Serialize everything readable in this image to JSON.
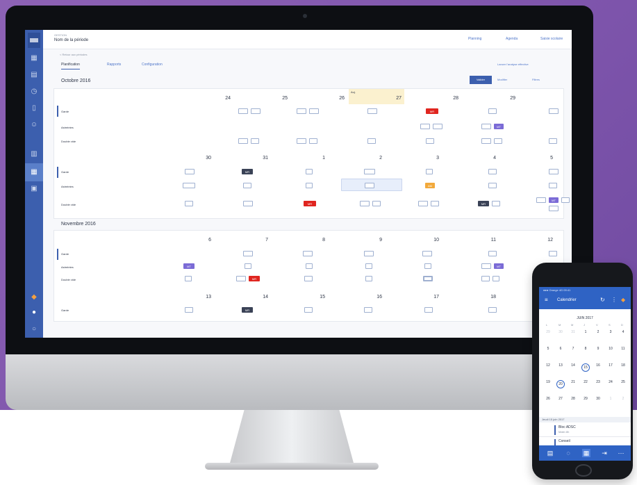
{
  "app": {
    "subtitle": "GESTION",
    "title": "Nom de la période",
    "actions": [
      "Planning",
      "Agenda",
      "Saisie scolaire"
    ]
  },
  "breadcrumb": "< Retour aux périodes",
  "tabs": [
    "Planification",
    "Rapports",
    "Configuration"
  ],
  "sync_label": "Lancer l'analyse effective",
  "toolbar": {
    "primary": "Valider",
    "link1": "Modifier",
    "link2": "Filtres"
  },
  "months": [
    "Octobre 2016",
    "Novembre 2016"
  ],
  "rows": [
    "Garde",
    "Astreintes",
    "Double vide"
  ],
  "week1_days": [
    "24",
    "25",
    "26",
    "27",
    "28",
    "29"
  ],
  "week2_days": [
    "30",
    "31",
    "1",
    "2",
    "3",
    "4",
    "5"
  ],
  "week3_days": [
    "6",
    "7",
    "8",
    "9",
    "10",
    "11",
    "12"
  ],
  "week4_days": [
    "13",
    "14",
    "15",
    "16",
    "17",
    "18"
  ],
  "today_label": "Auj.",
  "cell_labels": {
    "red": "MR",
    "purple": "MT",
    "dark": "MR",
    "orange": "AM"
  },
  "phone": {
    "status": "●●● Orange  4G   09:41",
    "title": "Calendrier",
    "month": "JUIN 2017",
    "dow": [
      "L",
      "M",
      "M",
      "J",
      "V",
      "S",
      "D"
    ],
    "list_head": "Jeudi 15 juin 2017",
    "items": [
      {
        "label": "Bloc ADSC",
        "sub": "Matin    8h"
      },
      {
        "label": "Conseil",
        "sub": ""
      }
    ]
  },
  "colors": {
    "accent": "#3c5fae",
    "alert": "#e0251f",
    "purple": "#7b6bd6",
    "warning": "#f2a93b",
    "background": "#8d62b5"
  }
}
